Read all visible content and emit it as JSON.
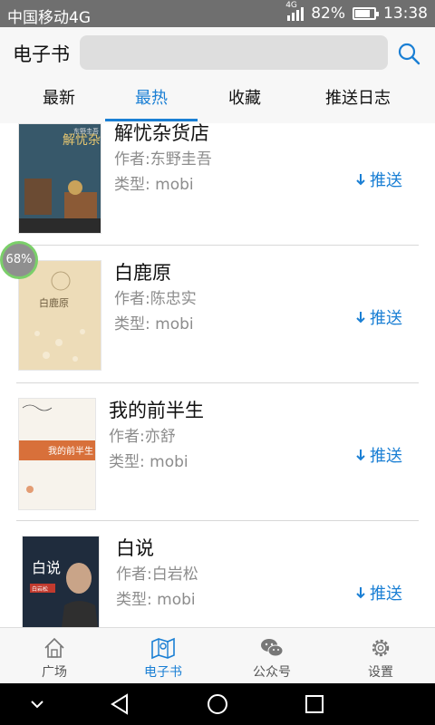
{
  "status_bar": {
    "carrier": "中国移动4G",
    "network": "4G",
    "battery": "82%",
    "battery_level": 0.82,
    "time": "13:38"
  },
  "header": {
    "title": "电子书",
    "search_placeholder": "",
    "search_icon": "search-icon"
  },
  "tabs": [
    {
      "label": "最新",
      "active": false
    },
    {
      "label": "最热",
      "active": true
    },
    {
      "label": "收藏",
      "active": false
    },
    {
      "label": "推送日志",
      "active": false
    }
  ],
  "books": [
    {
      "title": "解忧杂货店",
      "author": "作者:东野圭吾",
      "type": "类型: mobi",
      "push_label": "推送",
      "cover_text": "解忧杂货店",
      "cover_author": "东野圭吾"
    },
    {
      "title": "白鹿原",
      "author": "作者:陈忠实",
      "type": "类型: mobi",
      "push_label": "推送",
      "cover_text": "白鹿原"
    },
    {
      "title": "我的前半生",
      "author": "作者:亦舒",
      "type": "类型: mobi",
      "push_label": "推送",
      "cover_text": "我的前半生"
    },
    {
      "title": "白说",
      "author": "作者:白岩松",
      "type": "类型: mobi",
      "push_label": "推送",
      "cover_text": "白说",
      "cover_author": "白岩松"
    }
  ],
  "progress_badge": {
    "label": "68%"
  },
  "bottom_nav": [
    {
      "label": "广场",
      "icon": "home-icon",
      "active": false
    },
    {
      "label": "电子书",
      "icon": "map-book-icon",
      "active": true
    },
    {
      "label": "公众号",
      "icon": "wechat-icon",
      "active": false
    },
    {
      "label": "设置",
      "icon": "gear-icon",
      "active": false
    }
  ],
  "colors": {
    "accent": "#1a7fd4",
    "status_bar": "#6f6f6f",
    "badge_ring": "#7bcf6a"
  }
}
